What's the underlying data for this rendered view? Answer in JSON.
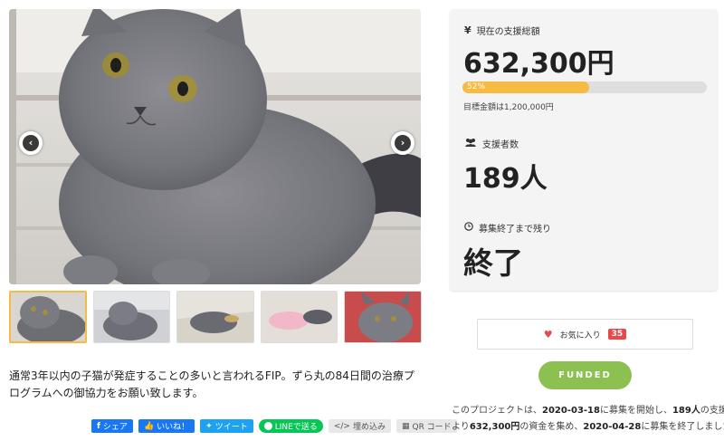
{
  "gallery": {
    "prev_arrow": "‹",
    "next_arrow": "›",
    "thumbnails": [
      {
        "alt": "cat-front",
        "active": true
      },
      {
        "alt": "cat-sitting",
        "active": false
      },
      {
        "alt": "cat-lying",
        "active": false
      },
      {
        "alt": "cat-with-person",
        "active": false
      },
      {
        "alt": "cat-closeup",
        "active": false
      }
    ]
  },
  "description": "通常3年以内の子猫が発症することの多いと言われるFIP。ずら丸の84日間の治療プログラムへの御協力をお願い致します。",
  "share": {
    "facebook": "シェア",
    "like": "いいね！",
    "tweet": "ツイート",
    "line": "LINEで送る",
    "embed": "埋め込み",
    "qr": "QR コード"
  },
  "stats": {
    "total_label": "現在の支援総額",
    "total_icon": "¥",
    "total_value": "632,300円",
    "progress_percent": 52,
    "progress_label": "52%",
    "goal_text": "目標金額は1,200,000円",
    "supporters_label": "支援者数",
    "supporters_value": "189人",
    "remaining_label": "募集終了まで残り",
    "remaining_value": "終了"
  },
  "favorite": {
    "label": "お気に入り",
    "count": "35"
  },
  "funded_label": "FUNDED",
  "summary": {
    "line1_a": "このプロジェクトは、",
    "start_date": "2020-03-18",
    "line1_b": "に募集を開始し、",
    "supporters": "189人",
    "line1_c": "の支援に",
    "line2_a": "より",
    "amount": "632,300円",
    "line2_b": "の資金を集め、",
    "end_date": "2020-04-28",
    "line2_c": "に募集を終了しました"
  },
  "colors": {
    "progress": "#f6bb42",
    "funded": "#8cc152",
    "badge": "#e64a4a",
    "facebook": "#1877f2",
    "twitter": "#1da1f2",
    "line": "#06c755"
  }
}
